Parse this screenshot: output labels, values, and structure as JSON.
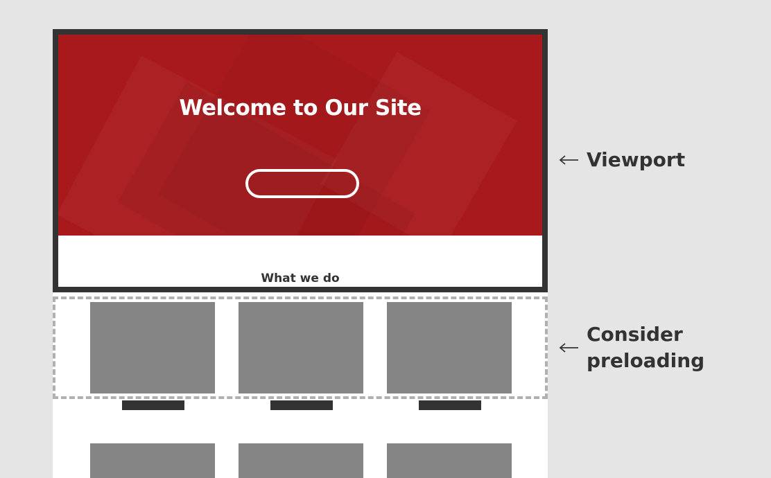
{
  "hero": {
    "title": "Welcome to Our Site",
    "cta_label": ""
  },
  "section": {
    "title": "What we do"
  },
  "annotations": {
    "viewport": "Viewport",
    "preload_line1": "Consider",
    "preload_line2": "preloading",
    "arrow_glyph": "left-arrow-icon"
  },
  "colors": {
    "background": "#e5e5e5",
    "hero": "#a8191c",
    "frame": "#333333",
    "placeholder": "#858585",
    "dashed": "#b0b0b0"
  },
  "cards": [
    {
      "caption": ""
    },
    {
      "caption": ""
    },
    {
      "caption": ""
    }
  ]
}
